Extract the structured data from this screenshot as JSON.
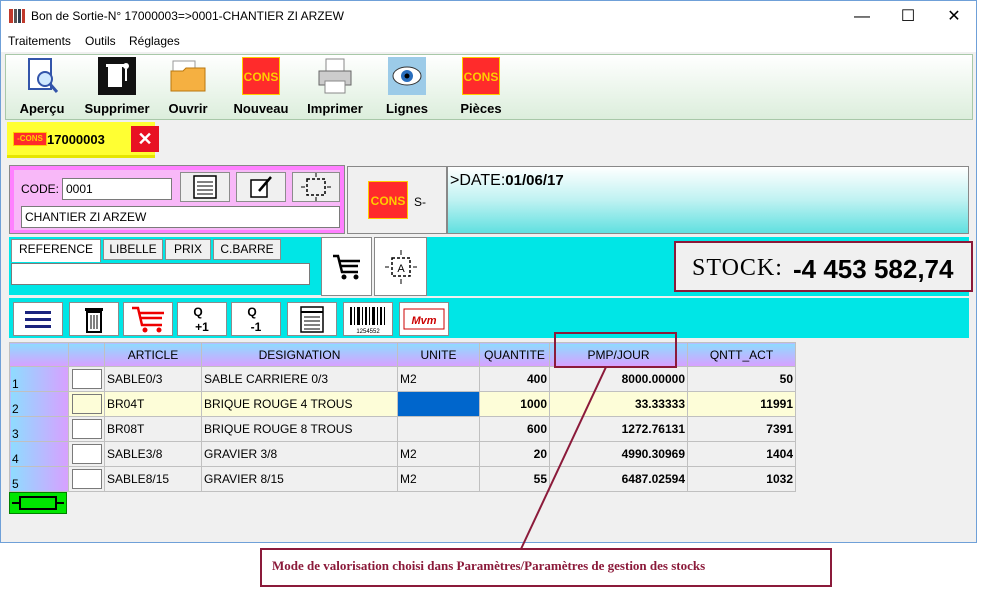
{
  "window": {
    "title": "Bon de Sortie-N° 17000003=>0001-CHANTIER ZI  ARZEW",
    "minimize": "—",
    "maximize": "☐",
    "close": "✕"
  },
  "menu": [
    {
      "label": "Traitements"
    },
    {
      "label": "Outils"
    },
    {
      "label": "Réglages"
    }
  ],
  "toolbar": [
    {
      "label": "Aperçu",
      "icon": "preview-icon"
    },
    {
      "label": "Supprimer",
      "icon": "trash-icon"
    },
    {
      "label": "Ouvrir",
      "icon": "folder-icon"
    },
    {
      "label": "Nouveau",
      "icon": "cons-logo-icon"
    },
    {
      "label": "Imprimer",
      "icon": "printer-icon"
    },
    {
      "label": "Lignes",
      "icon": "eye-icon"
    },
    {
      "label": "Pièces",
      "icon": "cons-logo-icon"
    }
  ],
  "doc_tab": {
    "badge": "-CONS",
    "number": "17000003",
    "close": "✕"
  },
  "client": {
    "code_label": "CODE:",
    "code_value": "0001",
    "name": "CHANTIER ZI  ARZEW"
  },
  "doc_type": {
    "logo": "-CONS",
    "label": "S-"
  },
  "header_info": {
    "date_prefix": ">DATE:",
    "date_value": "01/06/17"
  },
  "search": {
    "tabs": [
      "REFERENCE",
      "LIBELLE",
      "PRIX",
      "C.BARRE"
    ],
    "input_value": ""
  },
  "stock": {
    "label": "STOCK:",
    "value": "-4 453 582,74"
  },
  "actions": [
    {
      "name": "menu",
      "text": "≡"
    },
    {
      "name": "delete",
      "text": "🗑"
    },
    {
      "name": "cart",
      "text": "🛒"
    },
    {
      "name": "qty-plus",
      "text": "Q\n+1"
    },
    {
      "name": "qty-minus",
      "text": "Q\n-1"
    },
    {
      "name": "calendar",
      "text": "▦"
    },
    {
      "name": "barcode",
      "text": "1254552"
    },
    {
      "name": "mvm",
      "text": "Mvm"
    }
  ],
  "grid": {
    "columns": [
      "",
      "",
      "ARTICLE",
      "DESIGNATION",
      "UNITE",
      "QUANTITE",
      "PMP/JOUR",
      "QNTT_ACT"
    ],
    "rows": [
      {
        "n": "1",
        "article": "SABLE0/3",
        "designation": "SABLE CARRIERE 0/3",
        "unite": "M2",
        "quantite": "400",
        "pmp": "8000.00000",
        "qntt": "50"
      },
      {
        "n": "2",
        "article": "BR04T",
        "designation": "BRIQUE ROUGE 4 TROUS",
        "unite": "",
        "quantite": "1000",
        "pmp": "33.33333",
        "qntt": "11991"
      },
      {
        "n": "3",
        "article": "BR08T",
        "designation": "BRIQUE ROUGE 8 TROUS",
        "unite": "",
        "quantite": "600",
        "pmp": "1272.76131",
        "qntt": "7391"
      },
      {
        "n": "4",
        "article": "SABLE3/8",
        "designation": "GRAVIER 3/8",
        "unite": "M2",
        "quantite": "20",
        "pmp": "4990.30969",
        "qntt": "1404"
      },
      {
        "n": "5",
        "article": "SABLE8/15",
        "designation": "GRAVIER 8/15",
        "unite": "M2",
        "quantite": "55",
        "pmp": "6487.02594",
        "qntt": "1032"
      }
    ]
  },
  "callout": "Mode de valorisation choisi dans Paramètres/Paramètres de gestion des stocks",
  "colors": {
    "accent_cyan": "#00e6e6",
    "pink": "#ff80ff",
    "callout": "#8b1a3a",
    "tab_yellow": "#ffff33"
  }
}
